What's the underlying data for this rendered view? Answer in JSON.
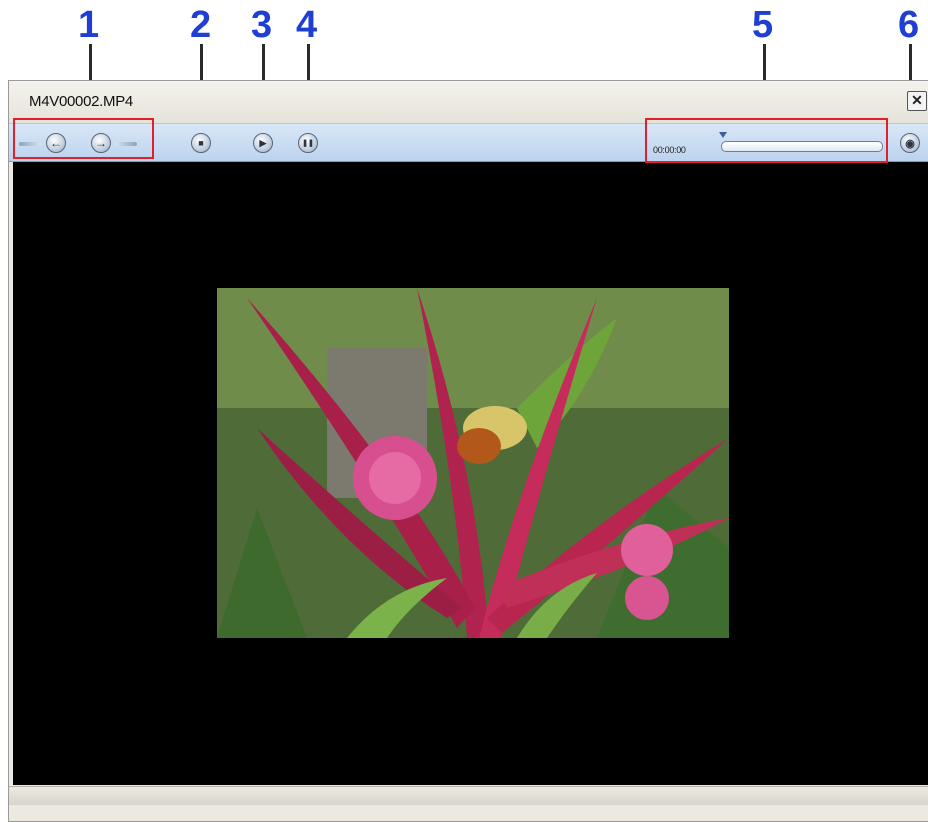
{
  "callouts": [
    "1",
    "2",
    "3",
    "4",
    "5",
    "6"
  ],
  "window": {
    "title": "M4V00002.MP4",
    "close_icon": "close-icon",
    "close_glyph": "✕"
  },
  "toolbar": {
    "prev_glyph": "←",
    "next_glyph": "→",
    "stop_glyph": "■",
    "play_glyph": "▶",
    "pause_glyph": "❚❚",
    "volume_glyph": "◉",
    "timecode": "00:00:00",
    "progress": 0
  },
  "colors": {
    "callout": "#1f3fd2",
    "highlight": "#e0202a",
    "toolbar": "#c9dcf2",
    "video_bg": "#000000"
  }
}
